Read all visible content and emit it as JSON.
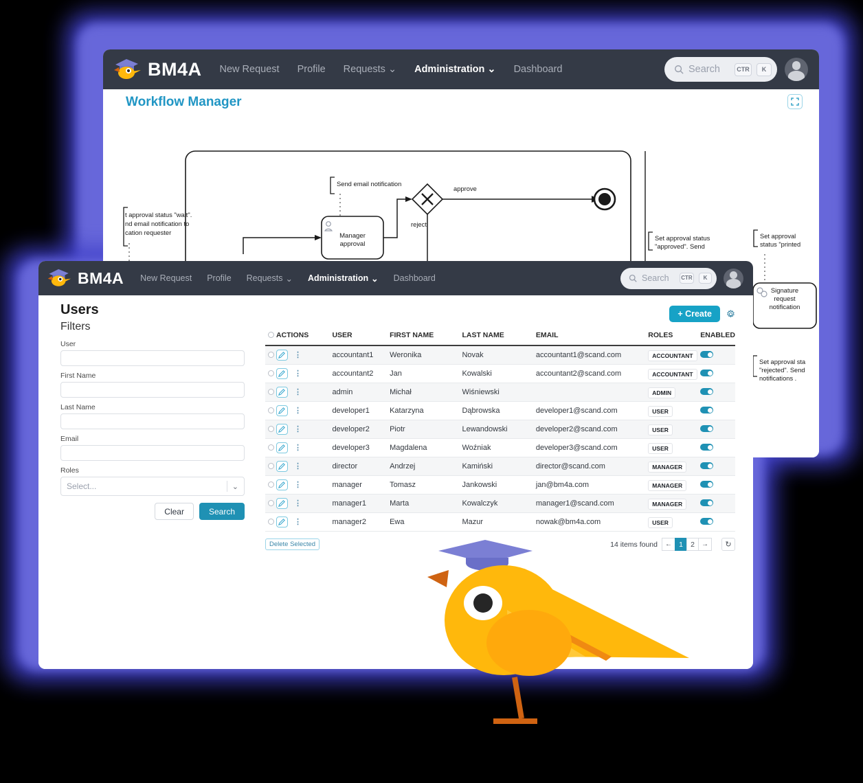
{
  "brand": {
    "name": "BM4A",
    "logo_icon": "bird-graduate-logo"
  },
  "back_window": {
    "nav": {
      "items": [
        {
          "label": "New Request",
          "active": false,
          "caret": false
        },
        {
          "label": "Profile",
          "active": false,
          "caret": false
        },
        {
          "label": "Requests",
          "active": false,
          "caret": true
        },
        {
          "label": "Administration",
          "active": true,
          "caret": true
        },
        {
          "label": "Dashboard",
          "active": false,
          "caret": false
        }
      ]
    },
    "search": {
      "placeholder": "Search",
      "key1": "CTR",
      "key2": "K",
      "icon": "search-icon"
    },
    "avatar_icon": "user-avatar",
    "page_title": "Workflow Manager",
    "expand_icon": "fullscreen-expand-icon",
    "diagram": {
      "type": "bpmn-workflow",
      "annotations": [
        "t approval status \"wait\". nd email notification to cation requester",
        "Send email notification",
        "Set approval status \"approved\". Send",
        "Set approval status \"printed",
        "Set approval status \"rejected\". Send notifications ."
      ],
      "tasks": [
        "Manager approval",
        "Signature request notification"
      ],
      "flow_labels": [
        "approve",
        "reject"
      ],
      "gateway": "exclusive-gateway-x",
      "end_event": "end-event"
    }
  },
  "front_window": {
    "nav": {
      "items": [
        {
          "label": "New Request",
          "active": false,
          "caret": false
        },
        {
          "label": "Profile",
          "active": false,
          "caret": false
        },
        {
          "label": "Requests",
          "active": false,
          "caret": true
        },
        {
          "label": "Administration",
          "active": true,
          "caret": true
        },
        {
          "label": "Dashboard",
          "active": false,
          "caret": false
        }
      ]
    },
    "search": {
      "placeholder": "Search",
      "key1": "CTR",
      "key2": "K",
      "icon": "search-icon"
    },
    "avatar_icon": "user-avatar",
    "page_title": "Users",
    "filters": {
      "heading": "Filters",
      "fields": [
        {
          "label": "User",
          "value": "",
          "placeholder": ""
        },
        {
          "label": "First Name",
          "value": "",
          "placeholder": ""
        },
        {
          "label": "Last Name",
          "value": "",
          "placeholder": ""
        },
        {
          "label": "Email",
          "value": "",
          "placeholder": ""
        }
      ],
      "roles": {
        "label": "Roles",
        "value": "Select...",
        "caret_icon": "chevron-down-icon"
      },
      "clear_label": "Clear",
      "search_label": "Search"
    },
    "toolbar": {
      "create_label": "+ Create",
      "settings_icon": "gear-icon"
    },
    "table": {
      "columns": [
        "ACTIONS",
        "USER",
        "FIRST NAME",
        "LAST NAME",
        "EMAIL",
        "ROLES",
        "ENABLED"
      ],
      "rows": [
        {
          "user": "accountant1",
          "first": "Weronika",
          "last": "Novak",
          "email": "accountant1@scand.com",
          "role": "ACCOUNTANT",
          "enabled": true
        },
        {
          "user": "accountant2",
          "first": "Jan",
          "last": "Kowalski",
          "email": "accountant2@scand.com",
          "role": "ACCOUNTANT",
          "enabled": true
        },
        {
          "user": "admin",
          "first": "Michał",
          "last": "Wiśniewski",
          "email": "",
          "role": "ADMIN",
          "enabled": true
        },
        {
          "user": "developer1",
          "first": "Katarzyna",
          "last": "Dąbrowska",
          "email": "developer1@scand.com",
          "role": "USER",
          "enabled": true
        },
        {
          "user": "developer2",
          "first": "Piotr",
          "last": "Lewandowski",
          "email": "developer2@scand.com",
          "role": "USER",
          "enabled": true
        },
        {
          "user": "developer3",
          "first": "Magdalena",
          "last": "Woźniak",
          "email": "developer3@scand.com",
          "role": "USER",
          "enabled": true
        },
        {
          "user": "director",
          "first": "Andrzej",
          "last": "Kamiński",
          "email": "director@scand.com",
          "role": "MANAGER",
          "enabled": true
        },
        {
          "user": "manager",
          "first": "Tomasz",
          "last": "Jankowski",
          "email": "jan@bm4a.com",
          "role": "MANAGER",
          "enabled": true
        },
        {
          "user": "manager1",
          "first": "Marta",
          "last": "Kowalczyk",
          "email": "manager1@scand.com",
          "role": "MANAGER",
          "enabled": true
        },
        {
          "user": "manager2",
          "first": "Ewa",
          "last": "Mazur",
          "email": "nowak@bm4a.com",
          "role": "USER",
          "enabled": true
        }
      ],
      "row_icons": {
        "edit": "pencil-edit-icon",
        "menu": "more-vertical-icon",
        "select": "row-checkbox"
      }
    },
    "footer": {
      "delete_label": "Delete Selected",
      "items_found": "14 items found",
      "prev_icon": "arrow-left-icon",
      "next_icon": "arrow-right-icon",
      "refresh_icon": "refresh-icon",
      "pages": [
        "1",
        "2"
      ],
      "current_page": "1"
    }
  },
  "mascot": {
    "name": "bm4a-bird-mascot",
    "cap_color": "#7b7fd4",
    "body_color": "#ffb80c",
    "beak_color": "#d2610f"
  },
  "colors": {
    "navbar": "#343a46",
    "accent_teal": "#1f91b4",
    "title_blue": "#2196c4",
    "glow": "#3f3fc8"
  }
}
